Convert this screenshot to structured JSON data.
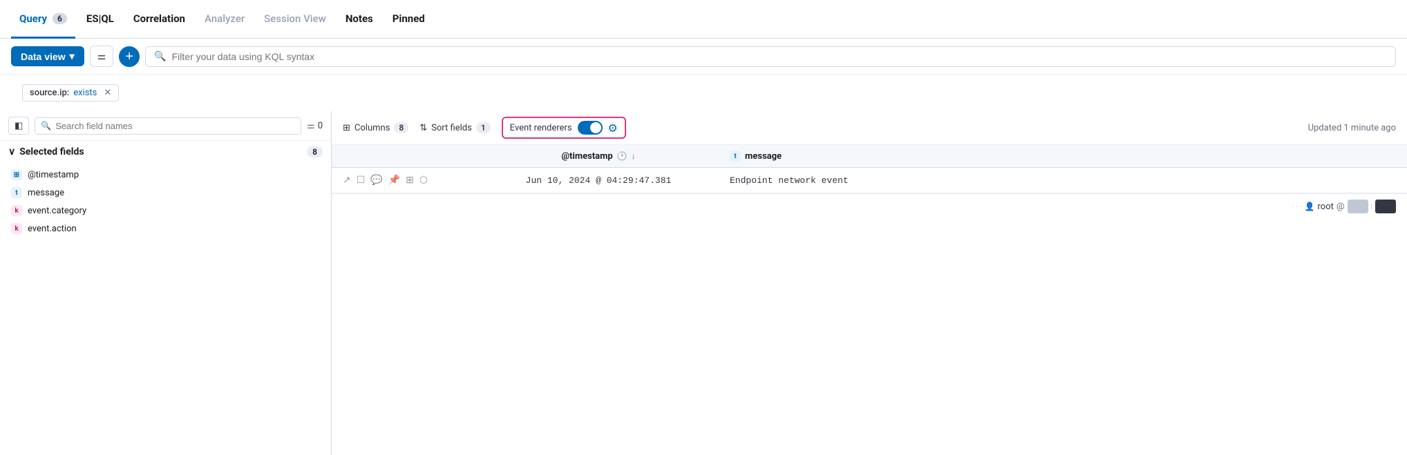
{
  "tabs": [
    {
      "id": "query",
      "label": "Query",
      "badge": "6",
      "active": true,
      "style": "active"
    },
    {
      "id": "esql",
      "label": "ES|QL",
      "style": "bold"
    },
    {
      "id": "correlation",
      "label": "Correlation",
      "style": "bold"
    },
    {
      "id": "analyzer",
      "label": "Analyzer",
      "style": "dimmed"
    },
    {
      "id": "session-view",
      "label": "Session View",
      "style": "dimmed"
    },
    {
      "id": "notes",
      "label": "Notes",
      "style": "bold"
    },
    {
      "id": "pinned",
      "label": "Pinned",
      "style": "bold"
    }
  ],
  "toolbar": {
    "data_view_label": "Data view",
    "search_placeholder": "Filter your data using KQL syntax"
  },
  "filter_tag": {
    "key": "source.ip:",
    "value": "exists"
  },
  "left_panel": {
    "search_placeholder": "Search field names",
    "filter_count": "0",
    "selected_fields": {
      "label": "Selected fields",
      "count": "8"
    },
    "fields": [
      {
        "name": "@timestamp",
        "type": "date"
      },
      {
        "name": "message",
        "type": "text"
      },
      {
        "name": "event.category",
        "type": "keyword"
      },
      {
        "name": "event.action",
        "type": "keyword"
      }
    ]
  },
  "right_panel": {
    "columns": {
      "label": "Columns",
      "count": "8"
    },
    "sort_fields": {
      "label": "Sort fields",
      "count": "1"
    },
    "event_renderers": {
      "label": "Event renderers"
    },
    "updated_text": "Updated 1 minute ago",
    "table": {
      "headers": [
        {
          "id": "timestamp",
          "label": "@timestamp",
          "has_clock": true,
          "has_sort": true
        },
        {
          "id": "message",
          "label": "message",
          "type": "t"
        }
      ],
      "rows": [
        {
          "timestamp": "Jun 10, 2024 @ 04:29:47.381",
          "message": "Endpoint network event"
        }
      ],
      "user_row": {
        "user": "root",
        "at": "@"
      }
    }
  }
}
